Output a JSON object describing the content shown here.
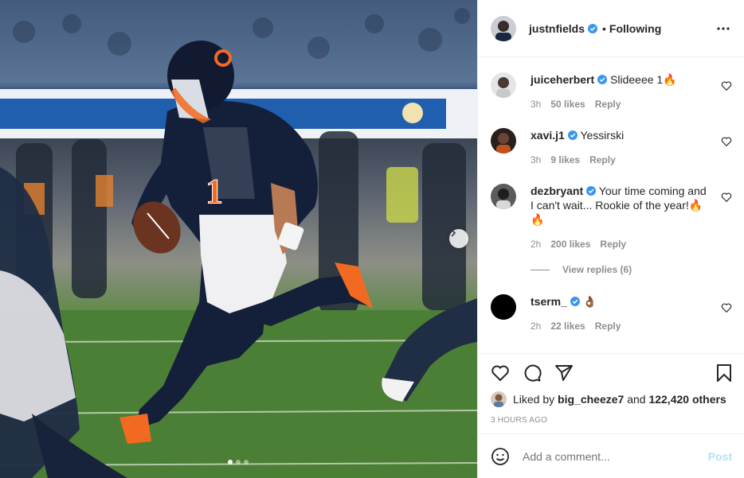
{
  "post": {
    "author": "justnfields",
    "separator": "•",
    "follow_status": "Following",
    "likes_text_prefix": "Liked by ",
    "liked_by_user": "big_cheeze7",
    "likes_text_middle": " and ",
    "likes_count": "122,420 others",
    "time_ago": "3 HOURS AGO",
    "carousel_position": 1,
    "carousel_total": 3
  },
  "comments": [
    {
      "username": "juiceherbert",
      "text": "Slideeee 1🔥",
      "time": "3h",
      "likes": "50 likes",
      "reply": "Reply"
    },
    {
      "username": "xavi.j1",
      "text": "Yessirski",
      "time": "3h",
      "likes": "9 likes",
      "reply": "Reply"
    },
    {
      "username": "dezbryant",
      "text": "Your time coming and I can't wait... Rookie of the year!🔥🔥",
      "time": "2h",
      "likes": "200 likes",
      "reply": "Reply",
      "view_replies": "View replies (6)"
    },
    {
      "username": "tserm_",
      "text": "👌🏾",
      "time": "2h",
      "likes": "22 likes",
      "reply": "Reply"
    }
  ],
  "composer": {
    "placeholder": "Add a comment...",
    "post_label": "Post"
  },
  "icons": {
    "verified": "verified-badge-icon",
    "more": "more-options-icon",
    "heart": "heart-icon",
    "comment": "comment-icon",
    "share": "share-icon",
    "bookmark": "bookmark-icon",
    "emoji": "emoji-icon",
    "next": "chevron-right-icon"
  },
  "colors": {
    "verified_blue": "#3897f0",
    "text": "#262626",
    "muted": "#8e8e8e",
    "post_disabled": "#b2dffc"
  }
}
